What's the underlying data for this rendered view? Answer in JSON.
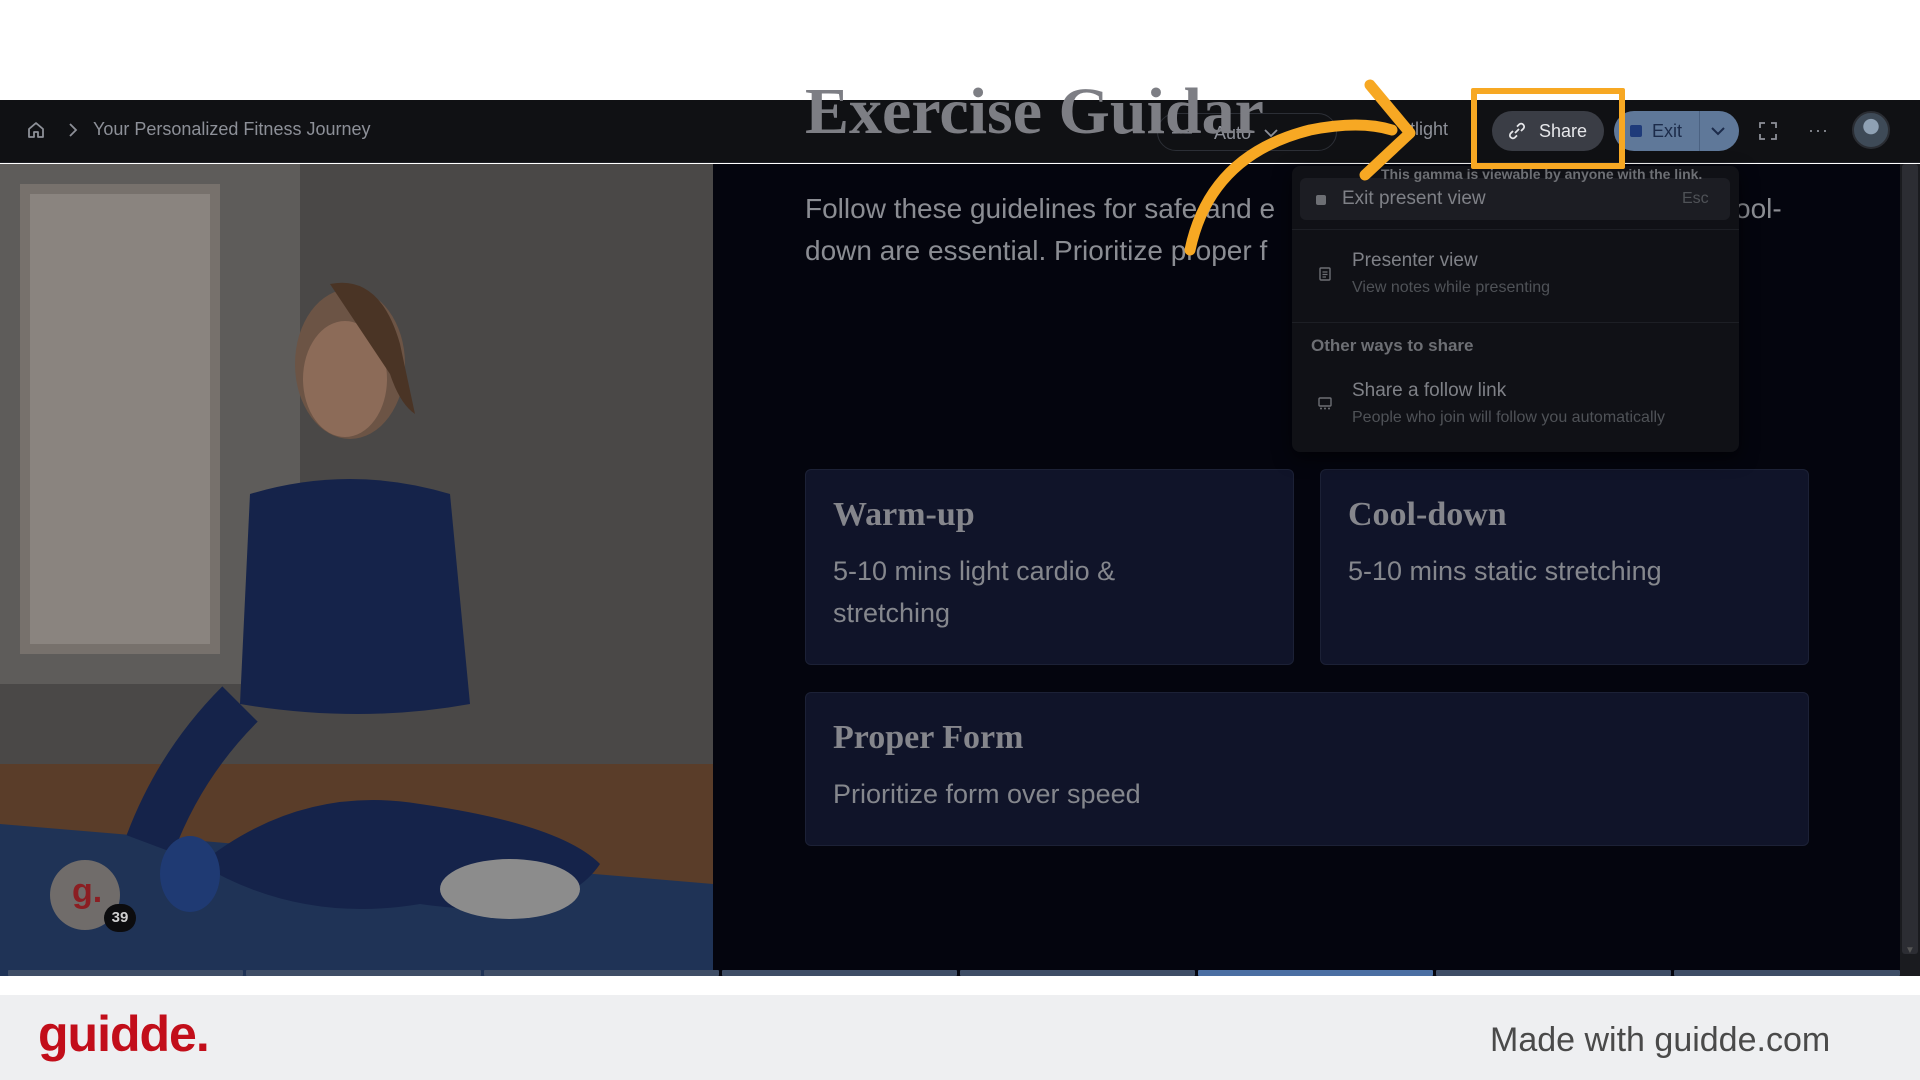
{
  "header": {
    "breadcrumb_title": "Your Personalized Fitness Journey",
    "zoom_minus": "—",
    "zoom_label": "Auto",
    "spotlight_label": "tlight",
    "share_label": "Share",
    "exit_label": "Exit",
    "more_label": "···"
  },
  "slide": {
    "title": "Exercise Guidar",
    "intro_line1": "Follow these guidelines for safe and e",
    "intro_line1_tail": "ool-",
    "intro_line2": "down are essential. Prioritize proper f",
    "cards": [
      {
        "title": "Warm-up",
        "body": "5-10 mins light cardio & stretching"
      },
      {
        "title": "Cool-down",
        "body": "5-10 mins static stretching"
      },
      {
        "title": "Proper Form",
        "body": "Prioritize form over speed"
      }
    ]
  },
  "menu": {
    "tooltip": "This gamma is viewable by anyone with the link.",
    "items": [
      {
        "title": "Exit present view",
        "shortcut": "Esc"
      },
      {
        "title": "Presenter view",
        "subtitle": "View notes while presenting"
      }
    ],
    "section_label": "Other ways to share",
    "share_items": [
      {
        "title": "Share a follow link",
        "subtitle": "People who join will follow you automatically"
      }
    ]
  },
  "badge": {
    "letter": "g.",
    "count": "39"
  },
  "footer": {
    "brand": "guidde.",
    "made_with": "Made with guidde.com"
  },
  "colors": {
    "accent_highlight": "#f7a823",
    "brand_red": "#c20e1a",
    "slide_bg": "#04050e"
  },
  "progress": {
    "segments": 8,
    "active_segment": 6
  }
}
